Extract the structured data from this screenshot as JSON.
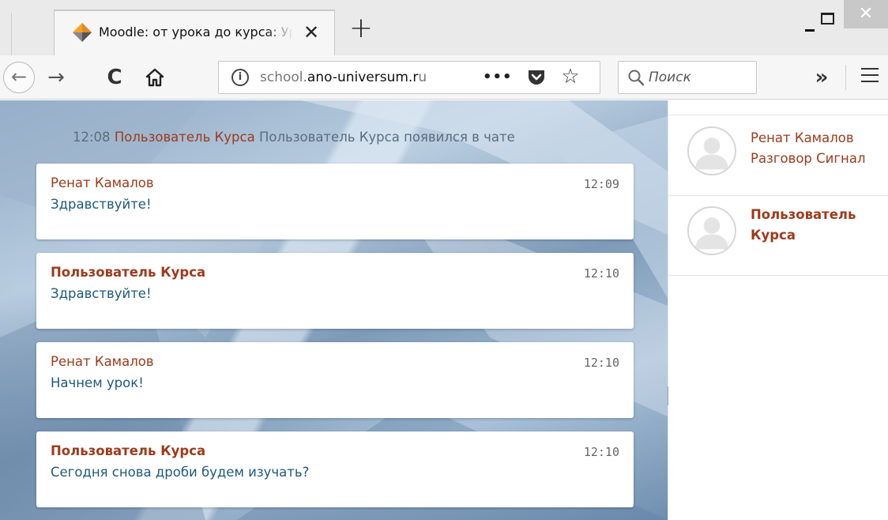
{
  "browser": {
    "tab": {
      "title": "Moodle: от урока до курса: Урок",
      "close_glyph": "✕",
      "icon": "moodle-diamond-icon"
    },
    "new_tab_glyph": "+",
    "window_controls": {
      "close_glyph": "✕"
    },
    "nav": {
      "back_glyph": "←",
      "forward_glyph": "→",
      "reload_glyph": "C",
      "home_glyph": "⌂",
      "info_glyph": "i",
      "url_prefix": "school.",
      "url_domain": "ano-universum.r",
      "url_suffix": "u",
      "page_actions_glyph": "•••",
      "star_glyph": "☆",
      "search_placeholder": "Поиск",
      "overflow_glyph": "»"
    }
  },
  "chat": {
    "system_message": {
      "time": "12:08",
      "user": "Пользователь Курса",
      "text": "Пользователь Курса появился в чате"
    },
    "messages": [
      {
        "author": "Ренат Камалов",
        "time": "12:09",
        "text": "Здравствуйте!",
        "author_bold": false
      },
      {
        "author": "Пользователь Курса",
        "time": "12:10",
        "text": "Здравствуйте!",
        "author_bold": true
      },
      {
        "author": "Ренат Камалов",
        "time": "12:10",
        "text": "Начнем урок!",
        "author_bold": false
      },
      {
        "author": "Пользователь Курса",
        "time": "12:10",
        "text": "Сегодня снова дроби будем изучать?",
        "author_bold": true
      }
    ]
  },
  "users": [
    {
      "name": "Ренат Камалов",
      "status": "Разговор Сигнал"
    },
    {
      "name": "Пользователь",
      "status": "Курса"
    }
  ],
  "colors": {
    "author": "#9c3b1c",
    "message_text": "#1f5a7a",
    "system_text": "#5b6d80"
  }
}
